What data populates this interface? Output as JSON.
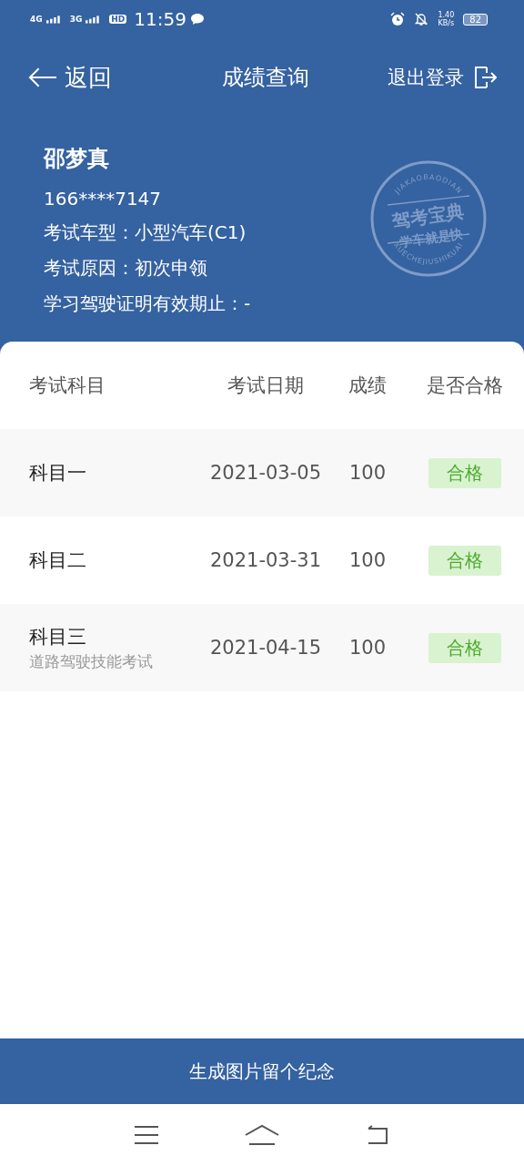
{
  "status_bar": {
    "network_1": "4G",
    "network_2": "3G",
    "hd": "HD",
    "time": "11:59",
    "speed": "1.40",
    "speed_unit": "KB/s",
    "battery": "82"
  },
  "nav": {
    "back": "返回",
    "title": "成绩查询",
    "logout": "退出登录"
  },
  "profile": {
    "name": "邵梦真",
    "phone": "166****7147",
    "lines": [
      "考试车型：小型汽车(C1)",
      "考试原因：初次申领",
      "学习驾驶证明有效期止：-"
    ]
  },
  "stamp": {
    "top": "JIAKAOBAODIAN",
    "line_1": "驾考宝典",
    "line_2": "学车就是快",
    "bottom": "XUECHEJIUSHIKUAI"
  },
  "table": {
    "columns": [
      "考试科目",
      "考试日期",
      "成绩",
      "是否合格"
    ],
    "rows": [
      {
        "subject": "科目一",
        "date": "2021-03-05",
        "score": "100",
        "result": "合格",
        "passed": true
      },
      {
        "subject": "科目二",
        "date": "2021-03-31",
        "score": "100",
        "result": "合格",
        "passed": true
      },
      {
        "subject": "科目三",
        "note": "道路驾驶技能考试",
        "date": "2021-04-15",
        "score": "100",
        "result": "合格",
        "passed": true
      }
    ]
  },
  "bottom_button": "生成图片留个纪念"
}
